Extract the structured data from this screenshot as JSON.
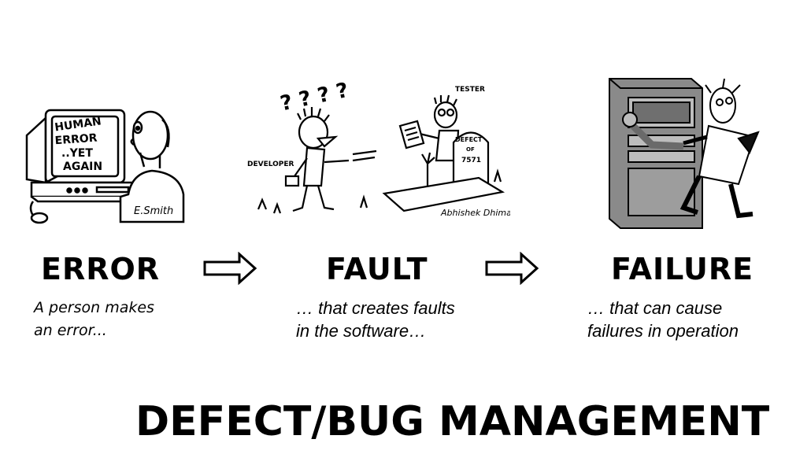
{
  "stages": [
    {
      "title": "ERROR",
      "caption_line1": "A person makes",
      "caption_line2": "an error...",
      "art_text": {
        "screen_line1": "HUMAN",
        "screen_line2": "ERROR",
        "screen_line3": "..YET",
        "screen_line4": "AGAIN",
        "signature": "E.Smith"
      }
    },
    {
      "title": "FAULT",
      "caption_line1": "… that creates faults",
      "caption_line2": "in the software…",
      "art_text": {
        "question_marks": "? ? ? ?",
        "developer_label": "DEVELOPER",
        "tester_label": "TESTER",
        "tomb_line1": "DEFECT",
        "tomb_line2": "OF",
        "tomb_line3": "7571",
        "artist_signature": "Abhishek Dhimas"
      }
    },
    {
      "title": "FAILURE",
      "caption_line1": "… that can cause",
      "caption_line2": "failures in operation"
    }
  ],
  "banner": {
    "title": "DEFECT/BUG MANAGEMENT"
  },
  "colors": {
    "text": "#000000",
    "background": "#ffffff",
    "server_gray": "#8a8a8a"
  }
}
